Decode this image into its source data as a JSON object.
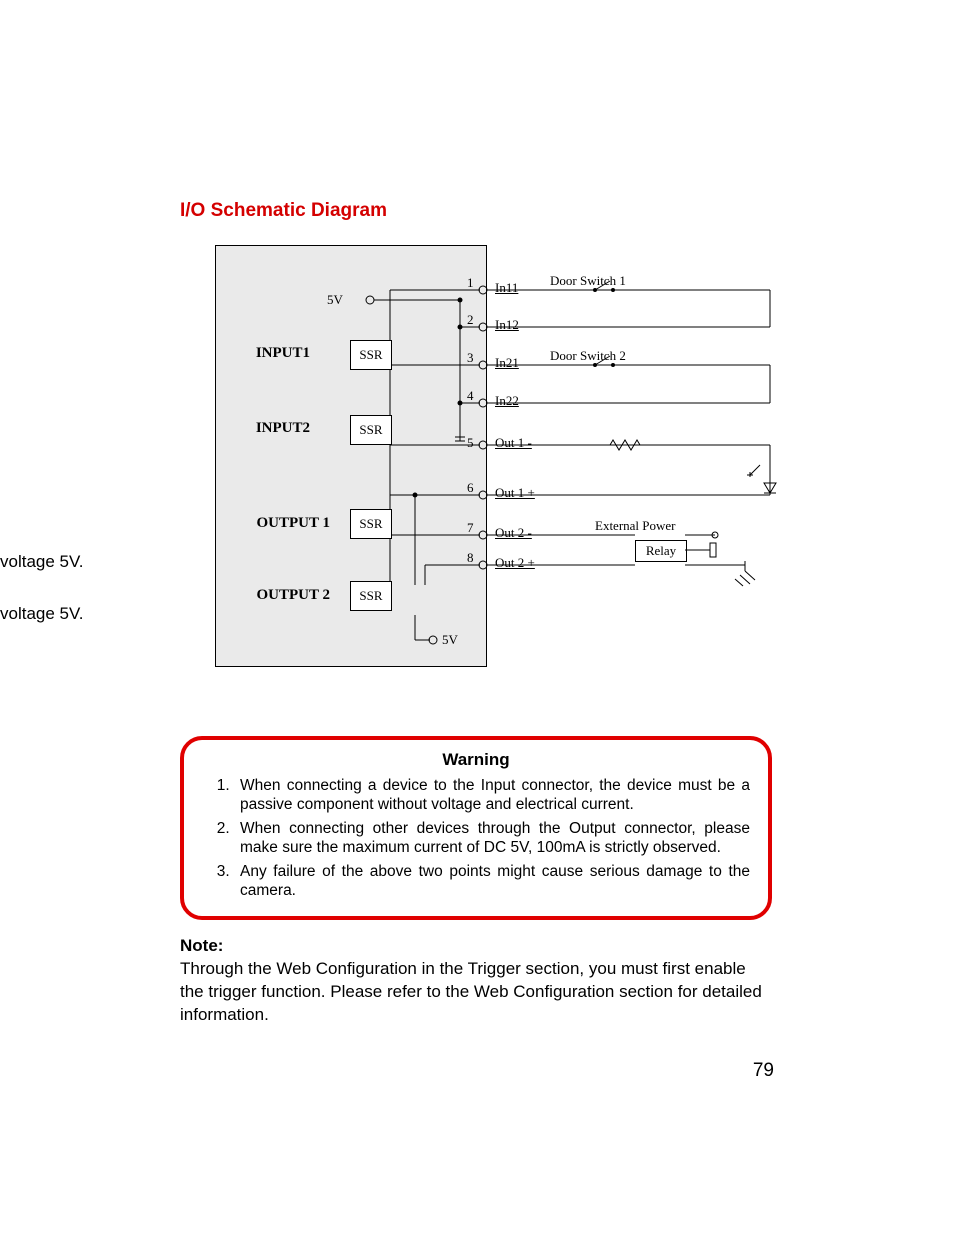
{
  "heading": "I/O Schematic Diagram",
  "side": {
    "text1": "voltage 5V.",
    "text2": "voltage 5V."
  },
  "diagram": {
    "fiveV_top": "5V",
    "fiveV_bottom": "5V",
    "inputs": [
      "INPUT1",
      "INPUT2"
    ],
    "outputs": [
      "OUTPUT 1",
      "OUTPUT 2"
    ],
    "ssr": "SSR",
    "pins": [
      {
        "num": "1",
        "label": "In11"
      },
      {
        "num": "2",
        "label": "In12"
      },
      {
        "num": "3",
        "label": "In21"
      },
      {
        "num": "4",
        "label": "In22"
      },
      {
        "num": "5",
        "label": "Out 1 -"
      },
      {
        "num": "6",
        "label": "Out 1 +"
      },
      {
        "num": "7",
        "label": "Out 2 -"
      },
      {
        "num": "8",
        "label": "Out 2 +"
      }
    ],
    "doorSwitch1": "Door Switch 1",
    "doorSwitch2": "Door Switch 2",
    "externalPower": "External Power",
    "relay": "Relay"
  },
  "warning": {
    "title": "Warning",
    "items": [
      "When connecting a device to the Input connector, the device must be a passive component without voltage and electrical current.",
      "When connecting other devices through the Output connector, please make sure the maximum current of DC 5V, 100mA is strictly observed.",
      "Any failure of the above two points might cause serious damage to the camera."
    ]
  },
  "note": {
    "label": "Note:",
    "body": "Through the Web Configuration in the Trigger section, you must first enable the trigger function. Please refer to the Web Configuration section for detailed information."
  },
  "pageNumber": "79"
}
